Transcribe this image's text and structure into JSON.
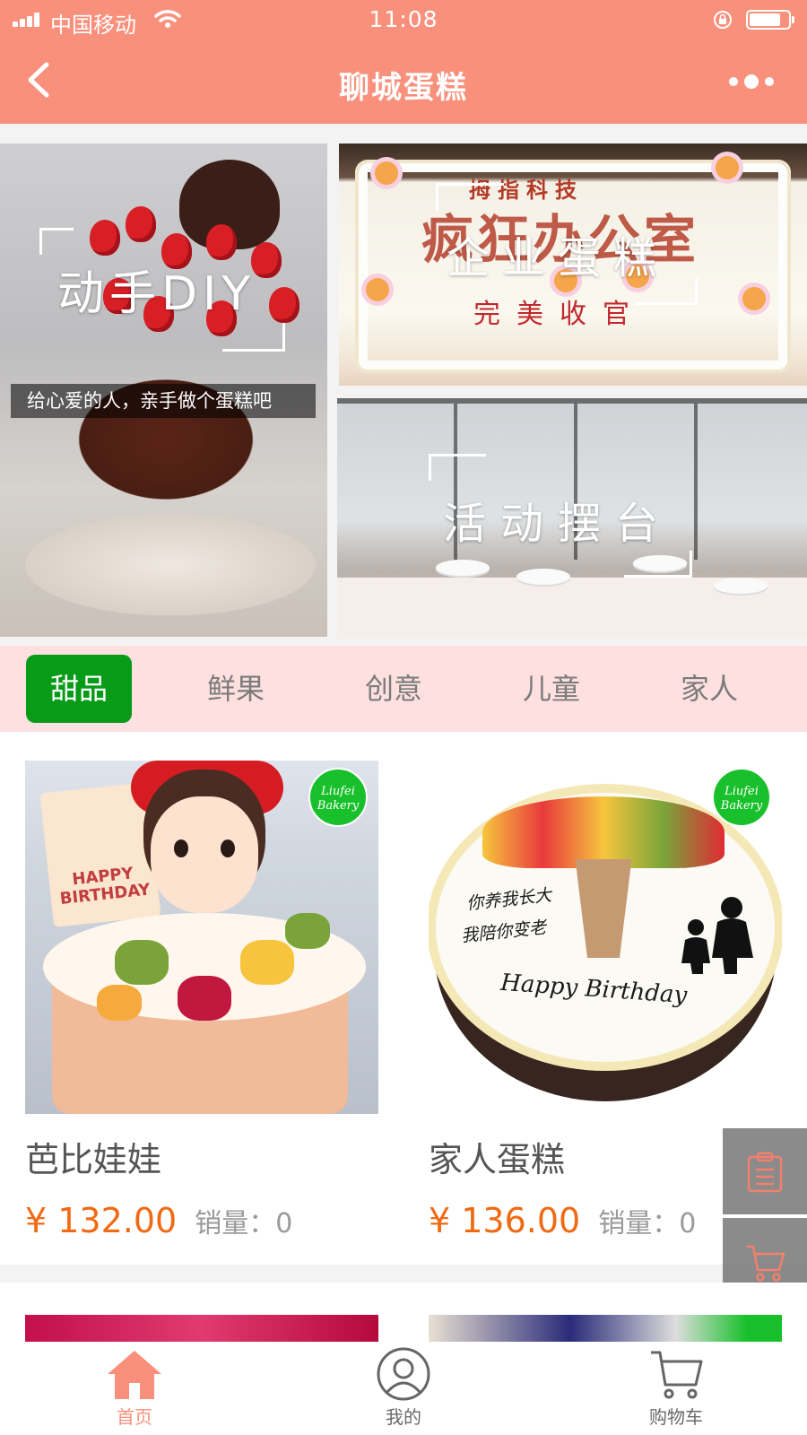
{
  "status_bar": {
    "carrier": "中国移动",
    "time": "11:08"
  },
  "nav": {
    "title": "聊城蛋糕",
    "back_icon": "chevron-left-icon",
    "more_icon": "more-dots-icon"
  },
  "banners": {
    "diy": {
      "title": "动手DIY",
      "subtitle": "给心爱的人，亲手做个蛋糕吧"
    },
    "corporate": {
      "title": "企业蛋糕",
      "cake_top": "拇指科技",
      "cake_big": "疯狂办公室",
      "cake_bottom": "完美收官"
    },
    "event": {
      "title": "活动摆台"
    }
  },
  "categories": [
    {
      "label": "甜品",
      "active": true
    },
    {
      "label": "鲜果",
      "active": false
    },
    {
      "label": "创意",
      "active": false
    },
    {
      "label": "儿童",
      "active": false
    },
    {
      "label": "家人",
      "active": false
    }
  ],
  "products": [
    {
      "name": "芭比娃娃",
      "price": "¥ 132.00",
      "sales_label": "销量：",
      "sales": "0",
      "badge": "Liufei Bakery",
      "card_text": "HAPPY BIRTHDAY"
    },
    {
      "name": "家人蛋糕",
      "price": "¥ 136.00",
      "sales_label": "销量：",
      "sales": "0",
      "badge": "Liufei Bakery",
      "card_text_1": "你养我长大",
      "card_text_2": "我陪你变老",
      "card_text_3": "Happy Birthday"
    }
  ],
  "floating_buttons": [
    {
      "icon": "clipboard-icon"
    },
    {
      "icon": "cart-icon"
    }
  ],
  "tabbar": [
    {
      "label": "首页",
      "icon": "home-icon",
      "active": true
    },
    {
      "label": "我的",
      "icon": "user-icon",
      "active": false
    },
    {
      "label": "购物车",
      "icon": "cart-icon",
      "active": false
    }
  ],
  "colors": {
    "header": "#f9907c",
    "tabs_bg": "#fde0df",
    "active_tab": "#079b17",
    "price": "#f06a14",
    "tabbar_active": "#f9907c"
  }
}
